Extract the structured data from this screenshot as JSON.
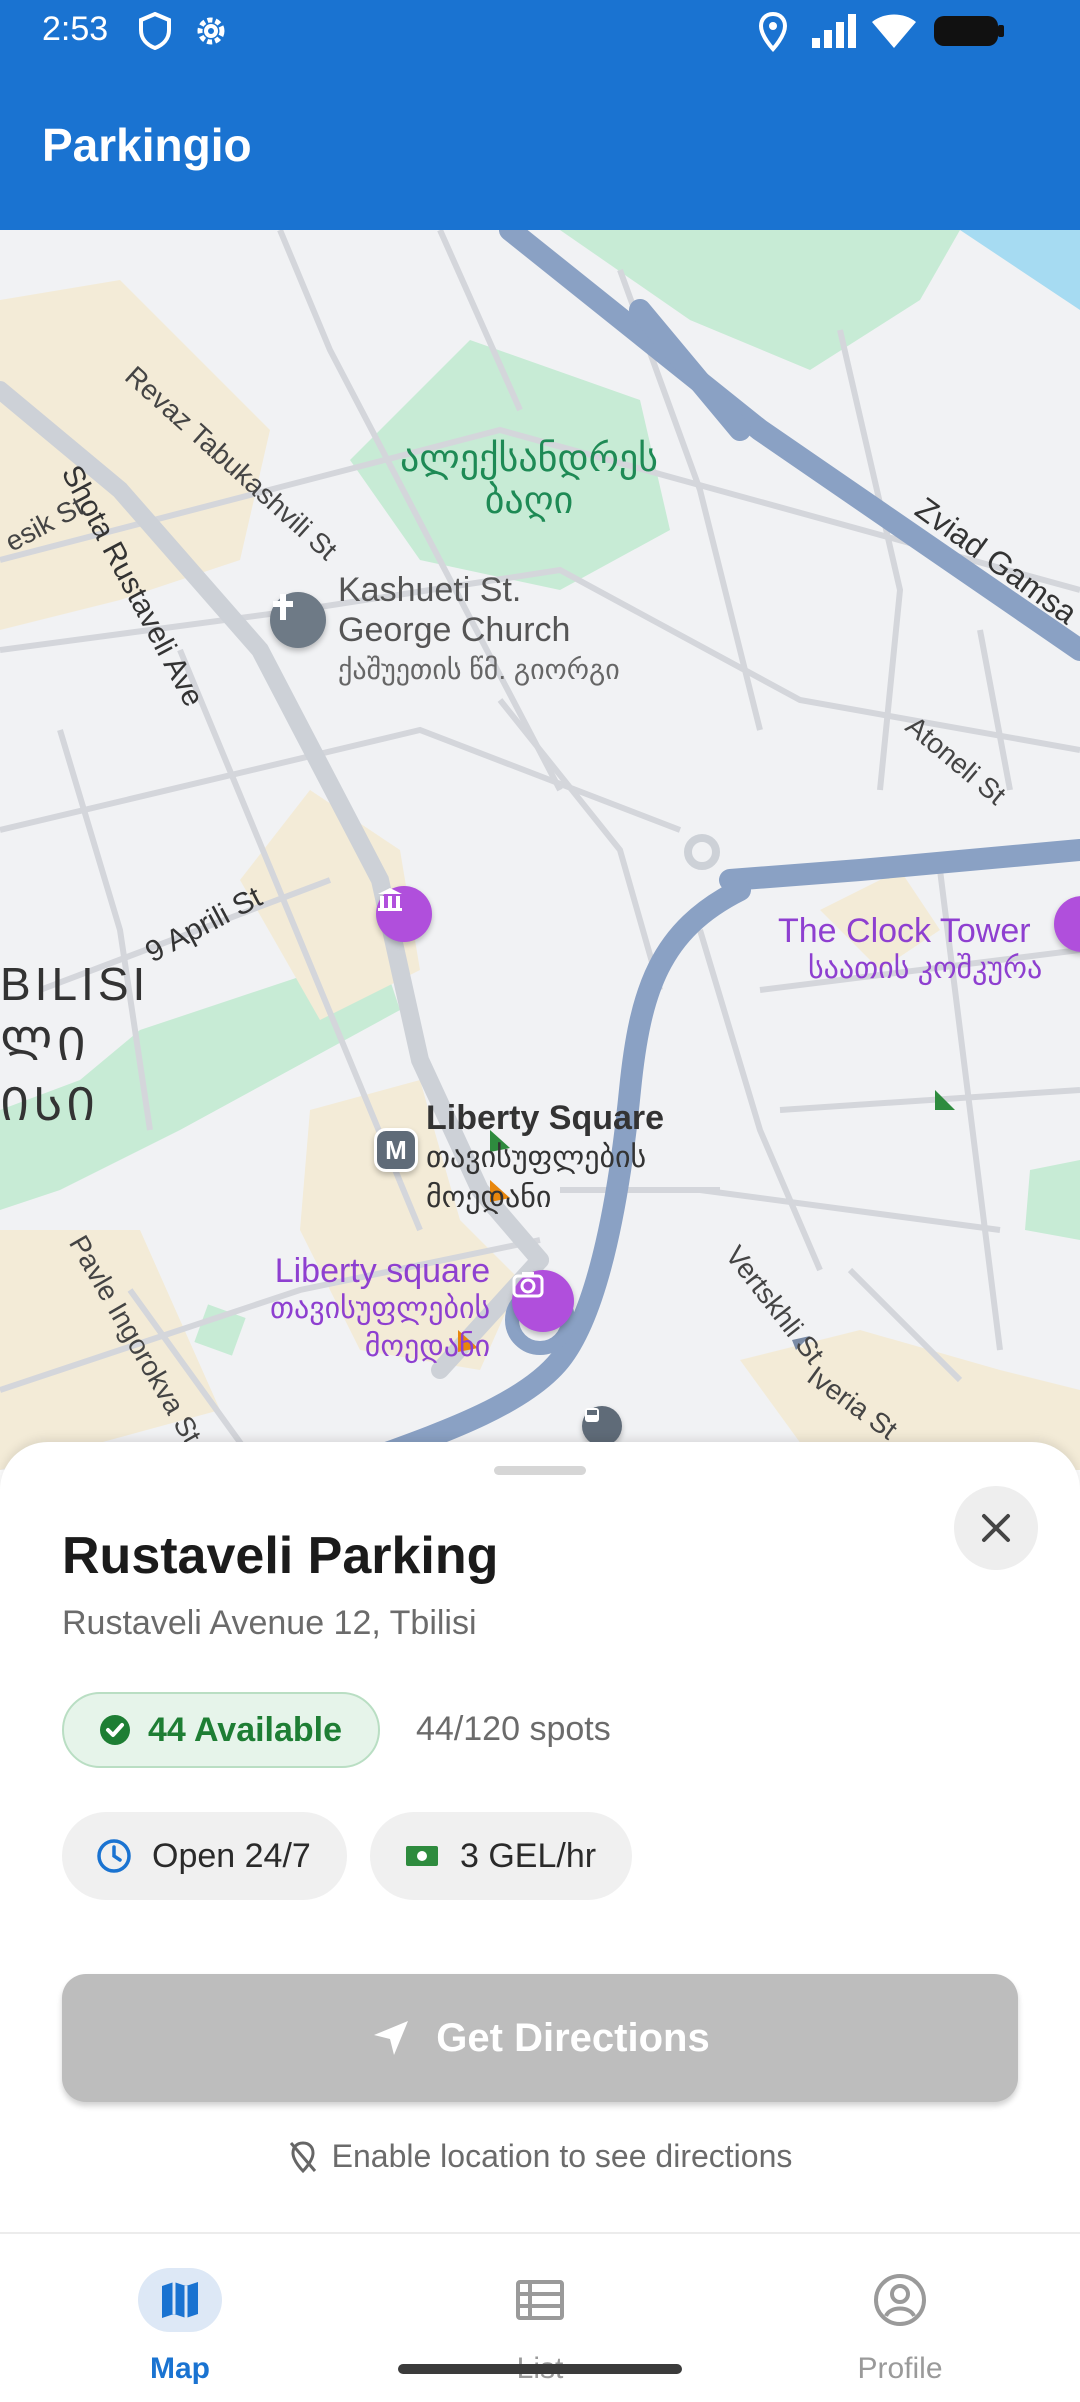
{
  "status_bar": {
    "time": "2:53"
  },
  "app_bar": {
    "title": "Parkingio"
  },
  "map": {
    "labels": {
      "revaz": "Revaz Tabukashvili St",
      "shota": "Shota Rustaveli Ave",
      "esik": "esik St",
      "park_ka_1": "ალექსანდრეს",
      "park_ka_2": "ბაღი",
      "church_1": "Kashueti St.",
      "church_2": "George Church",
      "church_ka": "ქაშუეთის წმ. გიორგი",
      "zviad": "Zviad Gamsa",
      "atoneli": "Atoneli St",
      "april": "9 Aprili St",
      "district_1": "BILISI",
      "district_2": "ᲚᲘ",
      "district_3": "ᲘᲡᲘ",
      "clock_1": "The Clock Tower",
      "clock_2": "საათის კოშკურა",
      "vertskhli": "Vertskhli St",
      "liberty_1": "Liberty Square",
      "liberty_2": "თავისუფლების",
      "liberty_3": "მოედანი",
      "liberty_sq_1": "Liberty square",
      "liberty_sq_2": "თავისუფლების",
      "liberty_sq_3": "მოედანი",
      "pavle": "Pavle Ingorokva St",
      "iveria": "Iveria St",
      "metro": "M"
    }
  },
  "parking": {
    "name": "Rustaveli Parking",
    "address": "Rustaveli Avenue 12, Tbilisi",
    "availability": "44 Available",
    "spots": "44/120 spots",
    "hours": "Open 24/7",
    "price": "3 GEL/hr",
    "directions_label": "Get Directions",
    "location_hint": "Enable location to see directions"
  },
  "nav": {
    "items": [
      {
        "label": "Map",
        "icon": "map-icon",
        "active": true
      },
      {
        "label": "List",
        "icon": "list-icon",
        "active": false
      },
      {
        "label": "Profile",
        "icon": "profile-icon",
        "active": false
      }
    ]
  },
  "colors": {
    "primary": "#1a73d1",
    "available_green": "#1e7e34",
    "poi_purple": "#8e3fd0",
    "disabled_button": "#bdbdbd"
  }
}
